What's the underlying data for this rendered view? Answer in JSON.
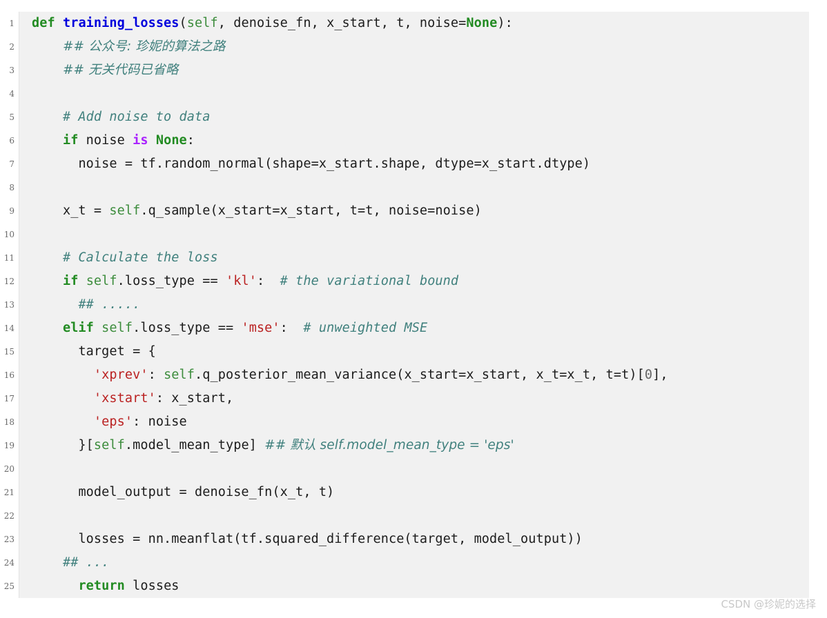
{
  "code_block": {
    "language": "python",
    "background_color": "#f1f1f1",
    "gutter_background_color": "#ffffff",
    "line_numbers": [
      "1",
      "2",
      "3",
      "4",
      "5",
      "6",
      "7",
      "8",
      "9",
      "10",
      "11",
      "12",
      "13",
      "14",
      "15",
      "16",
      "17",
      "18",
      "19",
      "20",
      "21",
      "22",
      "23",
      "24",
      "25"
    ],
    "lines": [
      {
        "n": "1",
        "text": "def training_losses(self, denoise_fn, x_start, t, noise=None):"
      },
      {
        "n": "2",
        "text": "    ## 公众号: 珍妮的算法之路"
      },
      {
        "n": "3",
        "text": "    ## 无关代码已省略"
      },
      {
        "n": "4",
        "text": ""
      },
      {
        "n": "5",
        "text": "    # Add noise to data"
      },
      {
        "n": "6",
        "text": "    if noise is None:"
      },
      {
        "n": "7",
        "text": "      noise = tf.random_normal(shape=x_start.shape, dtype=x_start.dtype)"
      },
      {
        "n": "8",
        "text": ""
      },
      {
        "n": "9",
        "text": "    x_t = self.q_sample(x_start=x_start, t=t, noise=noise)"
      },
      {
        "n": "10",
        "text": ""
      },
      {
        "n": "11",
        "text": "    # Calculate the loss"
      },
      {
        "n": "12",
        "text": "    if self.loss_type == 'kl':  # the variational bound"
      },
      {
        "n": "13",
        "text": "      ## ....."
      },
      {
        "n": "14",
        "text": "    elif self.loss_type == 'mse':  # unweighted MSE"
      },
      {
        "n": "15",
        "text": "      target = {"
      },
      {
        "n": "16",
        "text": "        'xprev': self.q_posterior_mean_variance(x_start=x_start, x_t=x_t, t=t)[0],"
      },
      {
        "n": "17",
        "text": "        'xstart': x_start,"
      },
      {
        "n": "18",
        "text": "        'eps': noise"
      },
      {
        "n": "19",
        "text": "      }[self.model_mean_type] ## 默认 self.model_mean_type = 'eps'"
      },
      {
        "n": "20",
        "text": ""
      },
      {
        "n": "21",
        "text": "      model_output = denoise_fn(x_t, t)"
      },
      {
        "n": "22",
        "text": ""
      },
      {
        "n": "23",
        "text": "      losses = nn.meanflat(tf.squared_difference(target, model_output))"
      },
      {
        "n": "24",
        "text": "    ## ..."
      },
      {
        "n": "25",
        "text": "      return losses"
      }
    ],
    "tokens": {
      "l1": {
        "kw_def": "def",
        "fn_name": "training_losses",
        "p1": "(",
        "self": "self",
        "args": ", denoise_fn, x_start, t, noise=",
        "none": "None",
        "p2": "):"
      },
      "l2": {
        "comment": "## 公众号: 珍妮的算法之路"
      },
      "l3": {
        "comment": "## 无关代码已省略"
      },
      "l5": {
        "comment": "# Add noise to data"
      },
      "l6": {
        "kw_if": "if",
        "mid": " noise ",
        "kw_is": "is",
        "none": "None",
        "end": ":"
      },
      "l7": {
        "text": "noise = tf.random_normal(shape=x_start.shape, dtype=x_start.dtype)"
      },
      "l9": {
        "pre": "x_t = ",
        "self": "self",
        "post": ".q_sample(x_start=x_start, t=t, noise=noise)"
      },
      "l11": {
        "comment": "# Calculate the loss"
      },
      "l12": {
        "kw_if": "if",
        "sp": " ",
        "self": "self",
        "mid": ".loss_type == ",
        "str": "'kl'",
        "colon": ":",
        "comment": "# the variational bound"
      },
      "l13": {
        "comment": "## ....."
      },
      "l14": {
        "kw_elif": "elif",
        "sp": " ",
        "self": "self",
        "mid": ".loss_type == ",
        "str": "'mse'",
        "colon": ":",
        "comment": "# unweighted MSE"
      },
      "l15": {
        "text": "target = {"
      },
      "l16": {
        "str": "'xprev'",
        "sep": ": ",
        "self": "self",
        "mid": ".q_posterior_mean_variance(x_start=x_start, x_t=x_t, t=t)[",
        "num": "0",
        "end": "],"
      },
      "l17": {
        "str": "'xstart'",
        "rest": ": x_start,"
      },
      "l18": {
        "str": "'eps'",
        "rest": ": noise"
      },
      "l19": {
        "pre": "}[",
        "self": "self",
        "post": ".model_mean_type] ",
        "comment": "## 默认 self.model_mean_type = 'eps'"
      },
      "l21": {
        "text": "model_output = denoise_fn(x_t, t)"
      },
      "l23": {
        "text": "losses = nn.meanflat(tf.squared_difference(target, model_output))"
      },
      "l24": {
        "comment": "## ..."
      },
      "l25": {
        "kw_return": "return",
        "rest": " losses"
      }
    },
    "colors": {
      "keyword": "#228B22",
      "operator_keyword": "#AA22FF",
      "function_name": "#0000DD",
      "self": "#3c8c3c",
      "string": "#BA2121",
      "number": "#666666",
      "comment": "#40807d",
      "text": "#1c1c1c",
      "line_number": "#6a6a6a"
    }
  },
  "watermark": {
    "text": "CSDN @珍妮的选择"
  }
}
